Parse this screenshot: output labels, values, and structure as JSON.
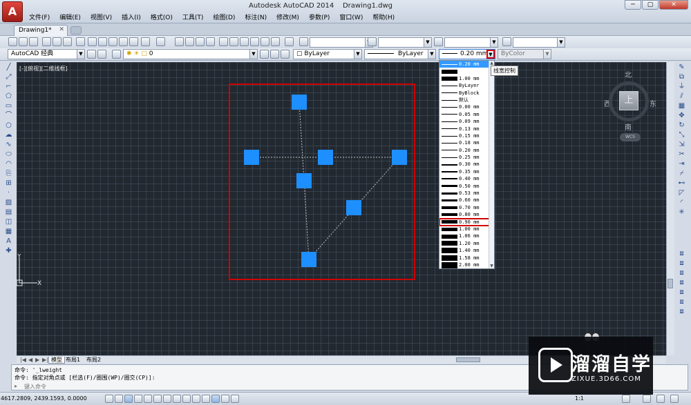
{
  "window": {
    "title": "Autodesk AutoCAD 2014    Drawing1.dwg",
    "app_logo": "A",
    "controls": {
      "minimize": "─",
      "maximize": "▢",
      "close": "✕"
    }
  },
  "menu": [
    "文件(F)",
    "编辑(E)",
    "视图(V)",
    "插入(I)",
    "格式(O)",
    "工具(T)",
    "绘图(D)",
    "标注(N)",
    "修改(M)",
    "参数(P)",
    "窗口(W)",
    "帮助(H)"
  ],
  "tabs": {
    "document": "Drawing1*",
    "close": "✕"
  },
  "toolbar": {
    "workspace": "AutoCAD 经典",
    "layer": "0",
    "color": "ByLayer",
    "linetype": "ByLayer",
    "lineweight": "0.20 mm",
    "plotstyle": "ByColor"
  },
  "viewport_label": "[-][俯视][二维线框]",
  "viewcube": {
    "north": "北",
    "south": "南",
    "east": "东",
    "west": "西",
    "top": "上",
    "wcs": "WCS"
  },
  "lineweight_tooltip": "线宽控制",
  "lineweight_dropdown": {
    "selected_index": 0,
    "highlighted_index": 22,
    "items": [
      {
        "label": "0.20 mm",
        "weight": 1
      },
      {
        "label": "",
        "weight": 6
      },
      {
        "label": "1.00 mm",
        "weight": 6
      },
      {
        "label": "ByLayer",
        "weight": 1
      },
      {
        "label": "ByBlock",
        "weight": 1
      },
      {
        "label": "默认",
        "weight": 1
      },
      {
        "label": "0.00 mm",
        "weight": 1
      },
      {
        "label": "0.05 mm",
        "weight": 1
      },
      {
        "label": "0.09 mm",
        "weight": 1
      },
      {
        "label": "0.13 mm",
        "weight": 1
      },
      {
        "label": "0.15 mm",
        "weight": 1
      },
      {
        "label": "0.18 mm",
        "weight": 1
      },
      {
        "label": "0.20 mm",
        "weight": 1
      },
      {
        "label": "0.25 mm",
        "weight": 1
      },
      {
        "label": "0.30 mm",
        "weight": 2
      },
      {
        "label": "0.35 mm",
        "weight": 2
      },
      {
        "label": "0.40 mm",
        "weight": 2
      },
      {
        "label": "0.50 mm",
        "weight": 3
      },
      {
        "label": "0.53 mm",
        "weight": 3
      },
      {
        "label": "0.60 mm",
        "weight": 3
      },
      {
        "label": "0.70 mm",
        "weight": 4
      },
      {
        "label": "0.80 mm",
        "weight": 4
      },
      {
        "label": "0.90 mm",
        "weight": 5
      },
      {
        "label": "1.00 mm",
        "weight": 5
      },
      {
        "label": "1.06 mm",
        "weight": 6
      },
      {
        "label": "1.20 mm",
        "weight": 7
      },
      {
        "label": "1.40 mm",
        "weight": 8
      },
      {
        "label": "1.58 mm",
        "weight": 8
      },
      {
        "label": "2.00 mm",
        "weight": 9
      },
      {
        "label": "2.11 mm",
        "weight": 10
      }
    ]
  },
  "layout_tabs": [
    "模型",
    "布局1",
    "布局2"
  ],
  "command": {
    "history": [
      "命令: '_lweight",
      "命令: 指定对角点或 [栏选(F)/圈围(WP)/圈交(CP)]:"
    ],
    "placeholder": "键入命令"
  },
  "status": {
    "coords": "4617.2809, 2439.1593, 0.0000",
    "scale": "1:1"
  },
  "ucs": {
    "x": "X",
    "y": "Y"
  },
  "watermark": {
    "title": "溜溜自学",
    "subtitle": "ZIXUE.3D66.COM"
  },
  "colors": {
    "selection_box": "#d00000",
    "grip": "#1e8fff",
    "canvas": "#212830",
    "selected_item": "#3399ff"
  }
}
